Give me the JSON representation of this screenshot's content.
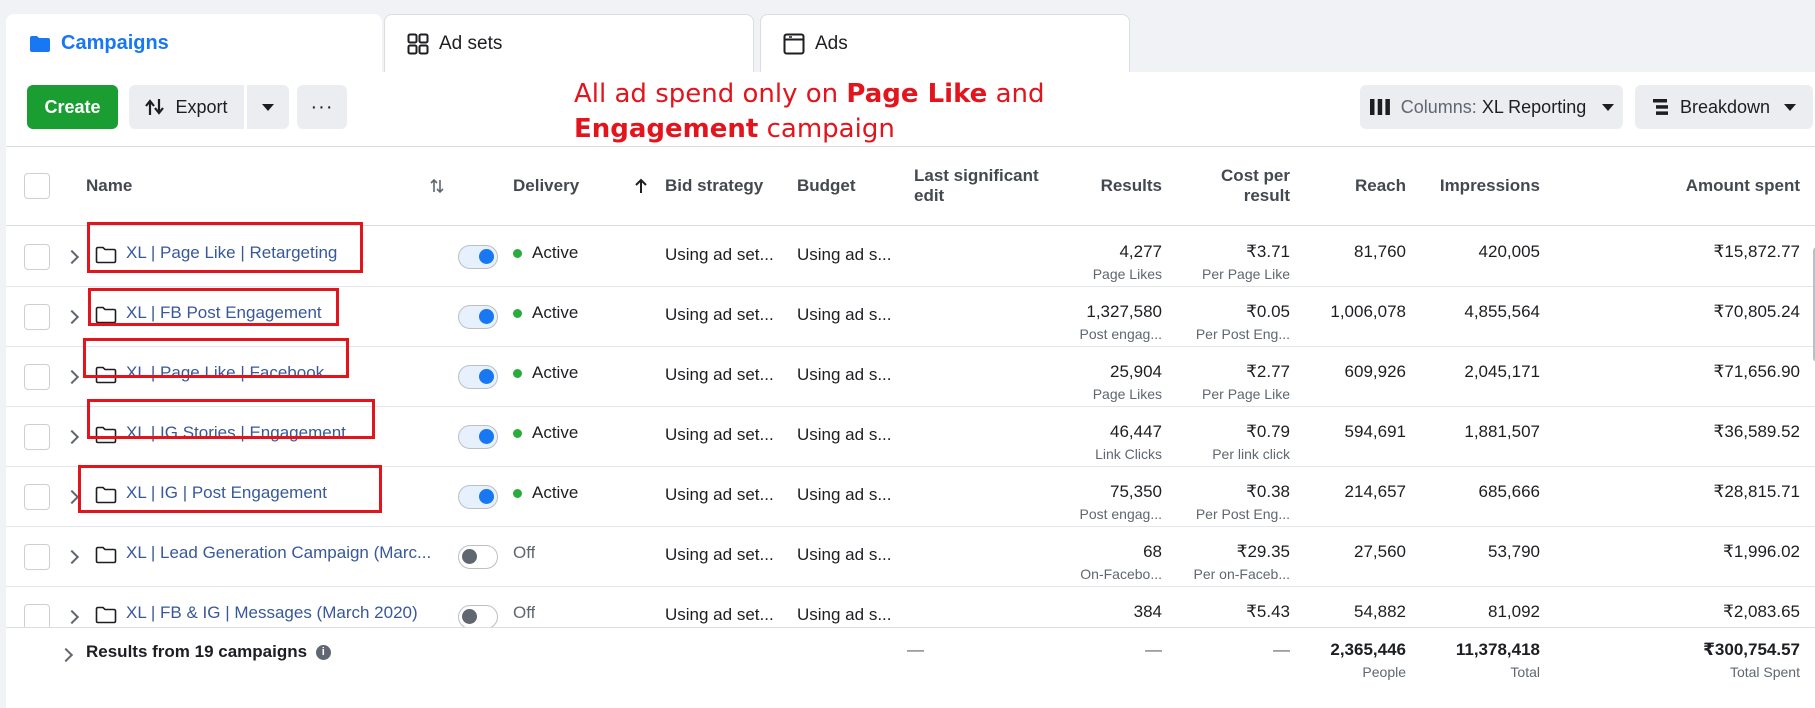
{
  "tabs": [
    {
      "label": "Campaigns",
      "icon": "folder-icon",
      "active": true
    },
    {
      "label": "Ad sets",
      "icon": "grid-icon",
      "active": false
    },
    {
      "label": "Ads",
      "icon": "ad-window-icon",
      "active": false
    }
  ],
  "toolbar": {
    "create_label": "Create",
    "export_label": "Export",
    "columns_prefix": "Columns:",
    "columns_value": "XL Reporting",
    "breakdown_label": "Breakdown"
  },
  "annotation": {
    "line1_prefix": "All ad spend only on ",
    "line1_bold": "Page Like",
    "line1_suffix": " and",
    "line2_bold": "Engagement",
    "line2_suffix": " campaign"
  },
  "headers": {
    "name": "Name",
    "delivery": "Delivery",
    "bid_strategy": "Bid strategy",
    "budget": "Budget",
    "last_edit": "Last significant edit",
    "results": "Results",
    "cost_per_result": "Cost per result",
    "reach": "Reach",
    "impressions": "Impressions",
    "amount_spent": "Amount spent"
  },
  "rows": [
    {
      "name": "XL | Page Like | Retargeting",
      "on": true,
      "delivery": "Active",
      "bid": "Using ad set...",
      "budget": "Using ad s...",
      "results": "4,277",
      "results_sub": "Page Likes",
      "cpr": "₹3.71",
      "cpr_sub": "Per Page Like",
      "reach": "81,760",
      "impressions": "420,005",
      "spent": "₹15,872.77"
    },
    {
      "name": "XL | FB Post Engagement",
      "on": true,
      "delivery": "Active",
      "bid": "Using ad set...",
      "budget": "Using ad s...",
      "results": "1,327,580",
      "results_sub": "Post engag...",
      "cpr": "₹0.05",
      "cpr_sub": "Per Post Eng...",
      "reach": "1,006,078",
      "impressions": "4,855,564",
      "spent": "₹70,805.24"
    },
    {
      "name": "XL | Page Like | Facebook",
      "on": true,
      "delivery": "Active",
      "bid": "Using ad set...",
      "budget": "Using ad s...",
      "results": "25,904",
      "results_sub": "Page Likes",
      "cpr": "₹2.77",
      "cpr_sub": "Per Page Like",
      "reach": "609,926",
      "impressions": "2,045,171",
      "spent": "₹71,656.90"
    },
    {
      "name": "XL | IG Stories | Engagement",
      "on": true,
      "delivery": "Active",
      "bid": "Using ad set...",
      "budget": "Using ad s...",
      "results": "46,447",
      "results_sub": "Link Clicks",
      "cpr": "₹0.79",
      "cpr_sub": "Per link click",
      "reach": "594,691",
      "impressions": "1,881,507",
      "spent": "₹36,589.52"
    },
    {
      "name": "XL | IG | Post Engagement",
      "on": true,
      "delivery": "Active",
      "bid": "Using ad set...",
      "budget": "Using ad s...",
      "results": "75,350",
      "results_sub": "Post engag...",
      "cpr": "₹0.38",
      "cpr_sub": "Per Post Eng...",
      "reach": "214,657",
      "impressions": "685,666",
      "spent": "₹28,815.71"
    },
    {
      "name": "XL | Lead Generation Campaign (Marc...",
      "on": false,
      "delivery": "Off",
      "bid": "Using ad set...",
      "budget": "Using ad s...",
      "results": "68",
      "results_sub": "On-Facebo...",
      "cpr": "₹29.35",
      "cpr_sub": "Per on-Faceb...",
      "reach": "27,560",
      "impressions": "53,790",
      "spent": "₹1,996.02"
    },
    {
      "name": "XL | FB & IG | Messages (March 2020)",
      "on": false,
      "delivery": "Off",
      "bid": "Using ad set...",
      "budget": "Using ad s...",
      "results": "384",
      "results_sub": "",
      "cpr": "₹5.43",
      "cpr_sub": "",
      "reach": "54,882",
      "impressions": "81,092",
      "spent": "₹2,083.65"
    }
  ],
  "footer": {
    "label": "Results from 19 campaigns",
    "dash": "—",
    "reach": "2,365,446",
    "reach_sub": "People",
    "impressions": "11,378,418",
    "impressions_sub": "Total",
    "spent": "₹300,754.57",
    "spent_sub": "Total Spent"
  },
  "colors": {
    "accent": "#1877f2",
    "create": "#1a9e32",
    "annotation": "#e3141c",
    "active_dot": "#2bab3c",
    "link": "#385898"
  }
}
